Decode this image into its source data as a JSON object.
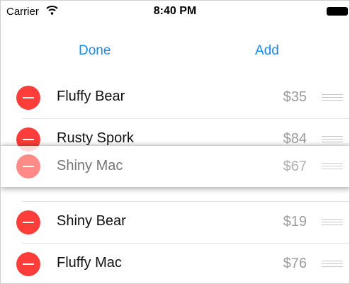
{
  "status_bar": {
    "carrier": "Carrier",
    "time": "8:40 PM",
    "wifi_icon": "wifi-icon",
    "battery_icon": "battery-icon"
  },
  "nav": {
    "left_button": "Done",
    "right_button": "Add",
    "accent_color": "#1a8cf0"
  },
  "items": [
    {
      "name": "Fluffy Bear",
      "price": "$35"
    },
    {
      "name": "Rusty Spork",
      "price": "$84"
    },
    {
      "name": "Shiny Bear",
      "price": "$19"
    },
    {
      "name": "Fluffy Mac",
      "price": "$76"
    }
  ],
  "dragging_item": {
    "name": "Shiny Mac",
    "price": "$67"
  },
  "colors": {
    "delete_red": "#fc3d39",
    "price_gray": "#9c9c9c"
  }
}
